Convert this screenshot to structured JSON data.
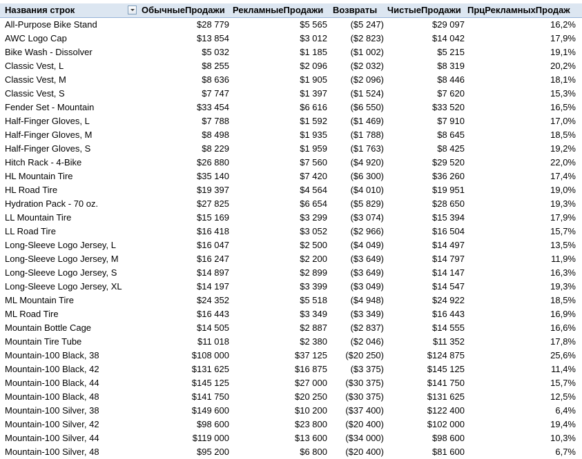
{
  "pivot": {
    "headers": {
      "row_labels": "Названия строк",
      "regular_sales": "ОбычныеПродажи",
      "promo_sales": "РекламныеПродажи",
      "returns": "Возвраты",
      "net_sales": "ЧистыеПродажи",
      "promo_pct": "ПрцРекламныхПродаж"
    },
    "rows": [
      {
        "name": "All-Purpose Bike Stand",
        "regular": "$28 779",
        "promo": "$5 565",
        "returns": "($5 247)",
        "net": "$29 097",
        "pct": "16,2%"
      },
      {
        "name": "AWC Logo Cap",
        "regular": "$13 854",
        "promo": "$3 012",
        "returns": "($2 823)",
        "net": "$14 042",
        "pct": "17,9%"
      },
      {
        "name": "Bike Wash - Dissolver",
        "regular": "$5 032",
        "promo": "$1 185",
        "returns": "($1 002)",
        "net": "$5 215",
        "pct": "19,1%"
      },
      {
        "name": "Classic Vest, L",
        "regular": "$8 255",
        "promo": "$2 096",
        "returns": "($2 032)",
        "net": "$8 319",
        "pct": "20,2%"
      },
      {
        "name": "Classic Vest, M",
        "regular": "$8 636",
        "promo": "$1 905",
        "returns": "($2 096)",
        "net": "$8 446",
        "pct": "18,1%"
      },
      {
        "name": "Classic Vest, S",
        "regular": "$7 747",
        "promo": "$1 397",
        "returns": "($1 524)",
        "net": "$7 620",
        "pct": "15,3%"
      },
      {
        "name": "Fender Set - Mountain",
        "regular": "$33 454",
        "promo": "$6 616",
        "returns": "($6 550)",
        "net": "$33 520",
        "pct": "16,5%"
      },
      {
        "name": "Half-Finger Gloves, L",
        "regular": "$7 788",
        "promo": "$1 592",
        "returns": "($1 469)",
        "net": "$7 910",
        "pct": "17,0%"
      },
      {
        "name": "Half-Finger Gloves, M",
        "regular": "$8 498",
        "promo": "$1 935",
        "returns": "($1 788)",
        "net": "$8 645",
        "pct": "18,5%"
      },
      {
        "name": "Half-Finger Gloves, S",
        "regular": "$8 229",
        "promo": "$1 959",
        "returns": "($1 763)",
        "net": "$8 425",
        "pct": "19,2%"
      },
      {
        "name": "Hitch Rack - 4-Bike",
        "regular": "$26 880",
        "promo": "$7 560",
        "returns": "($4 920)",
        "net": "$29 520",
        "pct": "22,0%"
      },
      {
        "name": "HL Mountain Tire",
        "regular": "$35 140",
        "promo": "$7 420",
        "returns": "($6 300)",
        "net": "$36 260",
        "pct": "17,4%"
      },
      {
        "name": "HL Road Tire",
        "regular": "$19 397",
        "promo": "$4 564",
        "returns": "($4 010)",
        "net": "$19 951",
        "pct": "19,0%"
      },
      {
        "name": "Hydration Pack - 70 oz.",
        "regular": "$27 825",
        "promo": "$6 654",
        "returns": "($5 829)",
        "net": "$28 650",
        "pct": "19,3%"
      },
      {
        "name": "LL Mountain Tire",
        "regular": "$15 169",
        "promo": "$3 299",
        "returns": "($3 074)",
        "net": "$15 394",
        "pct": "17,9%"
      },
      {
        "name": "LL Road Tire",
        "regular": "$16 418",
        "promo": "$3 052",
        "returns": "($2 966)",
        "net": "$16 504",
        "pct": "15,7%"
      },
      {
        "name": "Long-Sleeve Logo Jersey, L",
        "regular": "$16 047",
        "promo": "$2 500",
        "returns": "($4 049)",
        "net": "$14 497",
        "pct": "13,5%"
      },
      {
        "name": "Long-Sleeve Logo Jersey, M",
        "regular": "$16 247",
        "promo": "$2 200",
        "returns": "($3 649)",
        "net": "$14 797",
        "pct": "11,9%"
      },
      {
        "name": "Long-Sleeve Logo Jersey, S",
        "regular": "$14 897",
        "promo": "$2 899",
        "returns": "($3 649)",
        "net": "$14 147",
        "pct": "16,3%"
      },
      {
        "name": "Long-Sleeve Logo Jersey, XL",
        "regular": "$14 197",
        "promo": "$3 399",
        "returns": "($3 049)",
        "net": "$14 547",
        "pct": "19,3%"
      },
      {
        "name": "ML Mountain Tire",
        "regular": "$24 352",
        "promo": "$5 518",
        "returns": "($4 948)",
        "net": "$24 922",
        "pct": "18,5%"
      },
      {
        "name": "ML Road Tire",
        "regular": "$16 443",
        "promo": "$3 349",
        "returns": "($3 349)",
        "net": "$16 443",
        "pct": "16,9%"
      },
      {
        "name": "Mountain Bottle Cage",
        "regular": "$14 505",
        "promo": "$2 887",
        "returns": "($2 837)",
        "net": "$14 555",
        "pct": "16,6%"
      },
      {
        "name": "Mountain Tire Tube",
        "regular": "$11 018",
        "promo": "$2 380",
        "returns": "($2 046)",
        "net": "$11 352",
        "pct": "17,8%"
      },
      {
        "name": "Mountain-100 Black, 38",
        "regular": "$108 000",
        "promo": "$37 125",
        "returns": "($20 250)",
        "net": "$124 875",
        "pct": "25,6%"
      },
      {
        "name": "Mountain-100 Black, 42",
        "regular": "$131 625",
        "promo": "$16 875",
        "returns": "($3 375)",
        "net": "$145 125",
        "pct": "11,4%"
      },
      {
        "name": "Mountain-100 Black, 44",
        "regular": "$145 125",
        "promo": "$27 000",
        "returns": "($30 375)",
        "net": "$141 750",
        "pct": "15,7%"
      },
      {
        "name": "Mountain-100 Black, 48",
        "regular": "$141 750",
        "promo": "$20 250",
        "returns": "($30 375)",
        "net": "$131 625",
        "pct": "12,5%"
      },
      {
        "name": "Mountain-100 Silver, 38",
        "regular": "$149 600",
        "promo": "$10 200",
        "returns": "($37 400)",
        "net": "$122 400",
        "pct": "6,4%"
      },
      {
        "name": "Mountain-100 Silver, 42",
        "regular": "$98 600",
        "promo": "$23 800",
        "returns": "($20 400)",
        "net": "$102 000",
        "pct": "19,4%"
      },
      {
        "name": "Mountain-100 Silver, 44",
        "regular": "$119 000",
        "promo": "$13 600",
        "returns": "($34 000)",
        "net": "$98 600",
        "pct": "10,3%"
      },
      {
        "name": "Mountain-100 Silver, 48",
        "regular": "$95 200",
        "promo": "$6 800",
        "returns": "($20 400)",
        "net": "$81 600",
        "pct": "6,7%"
      }
    ]
  }
}
